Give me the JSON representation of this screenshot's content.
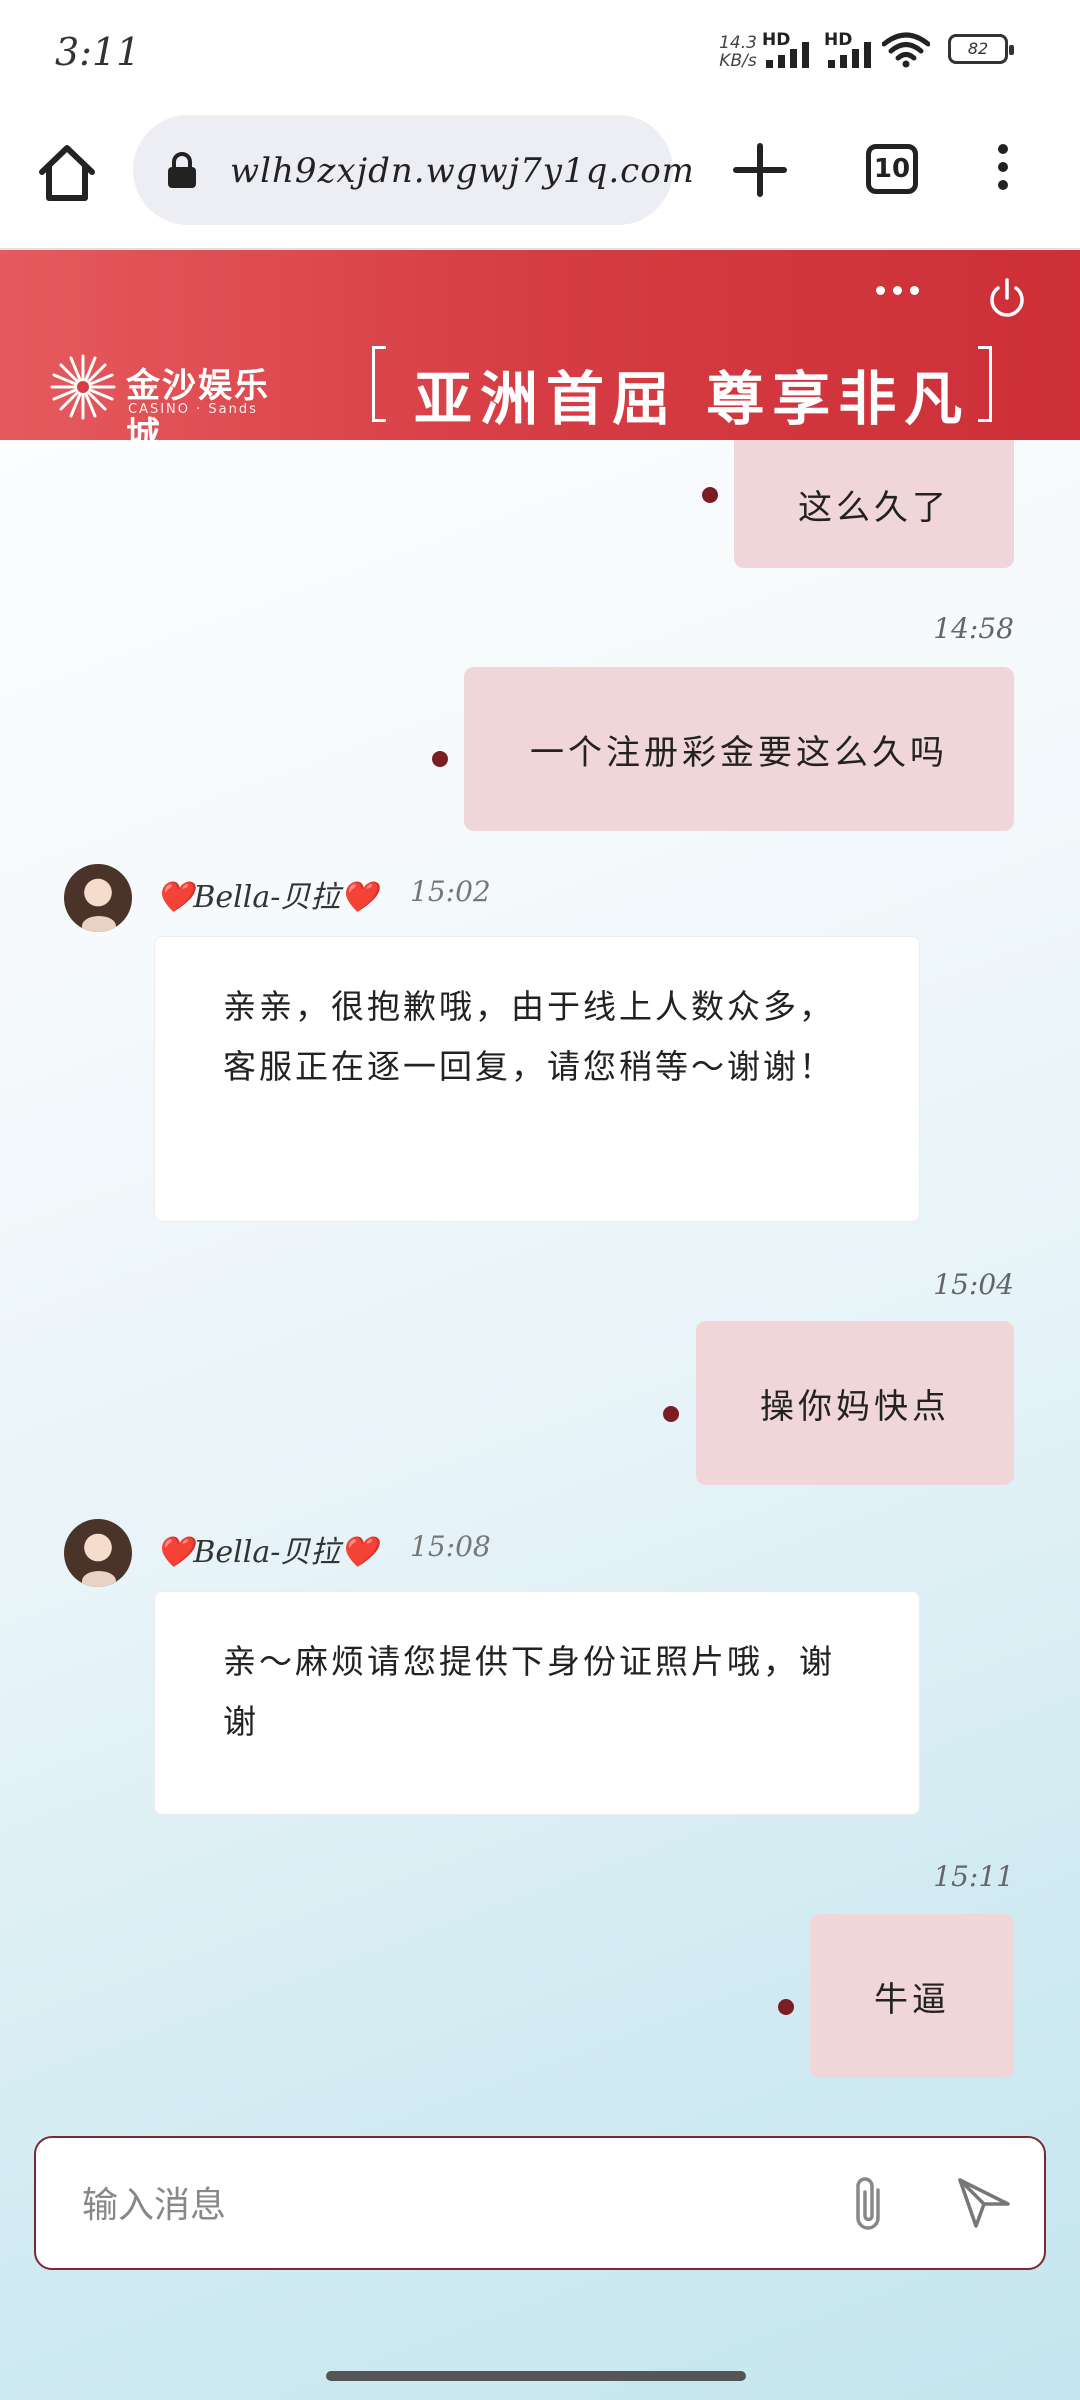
{
  "status_bar": {
    "time": "3:11",
    "net_speed_value": "14.3",
    "net_speed_unit": "KB/s",
    "sim1_label": "HD",
    "sim2_label": "HD",
    "battery": "82"
  },
  "browser": {
    "url": "wlh9zxjdn.wgwj7y1q.com",
    "tab_count": "10"
  },
  "header": {
    "brand_name": "金沙娱乐城",
    "brand_sub": "CASINO · Sands",
    "slogan": "亚洲首屈 尊享非凡",
    "accent_color": "#d63c43"
  },
  "messages": [
    {
      "side": "out",
      "text": "这么久了"
    },
    {
      "side": "out",
      "time": "14:58",
      "text": "一个注册彩金要这么久吗"
    },
    {
      "side": "in",
      "name": "❤️Bella-贝拉❤️",
      "time": "15:02",
      "text": "亲亲，很抱歉哦，由于线上人数众多，客服正在逐一回复，请您稍等～谢谢！"
    },
    {
      "side": "out",
      "time": "15:04",
      "text": "操你妈快点"
    },
    {
      "side": "in",
      "name": "❤️Bella-贝拉❤️",
      "time": "15:08",
      "text": "亲～麻烦请您提供下身份证照片哦，谢谢"
    },
    {
      "side": "out",
      "time": "15:11",
      "text": "牛逼"
    }
  ],
  "input": {
    "placeholder": "输入消息"
  },
  "icons": {
    "home": "home-icon",
    "lock": "lock-icon",
    "new_tab": "plus-icon",
    "menu": "more-vertical-icon",
    "more": "more-horizontal-icon",
    "power": "power-icon",
    "attach": "paperclip-icon",
    "send": "send-icon"
  }
}
